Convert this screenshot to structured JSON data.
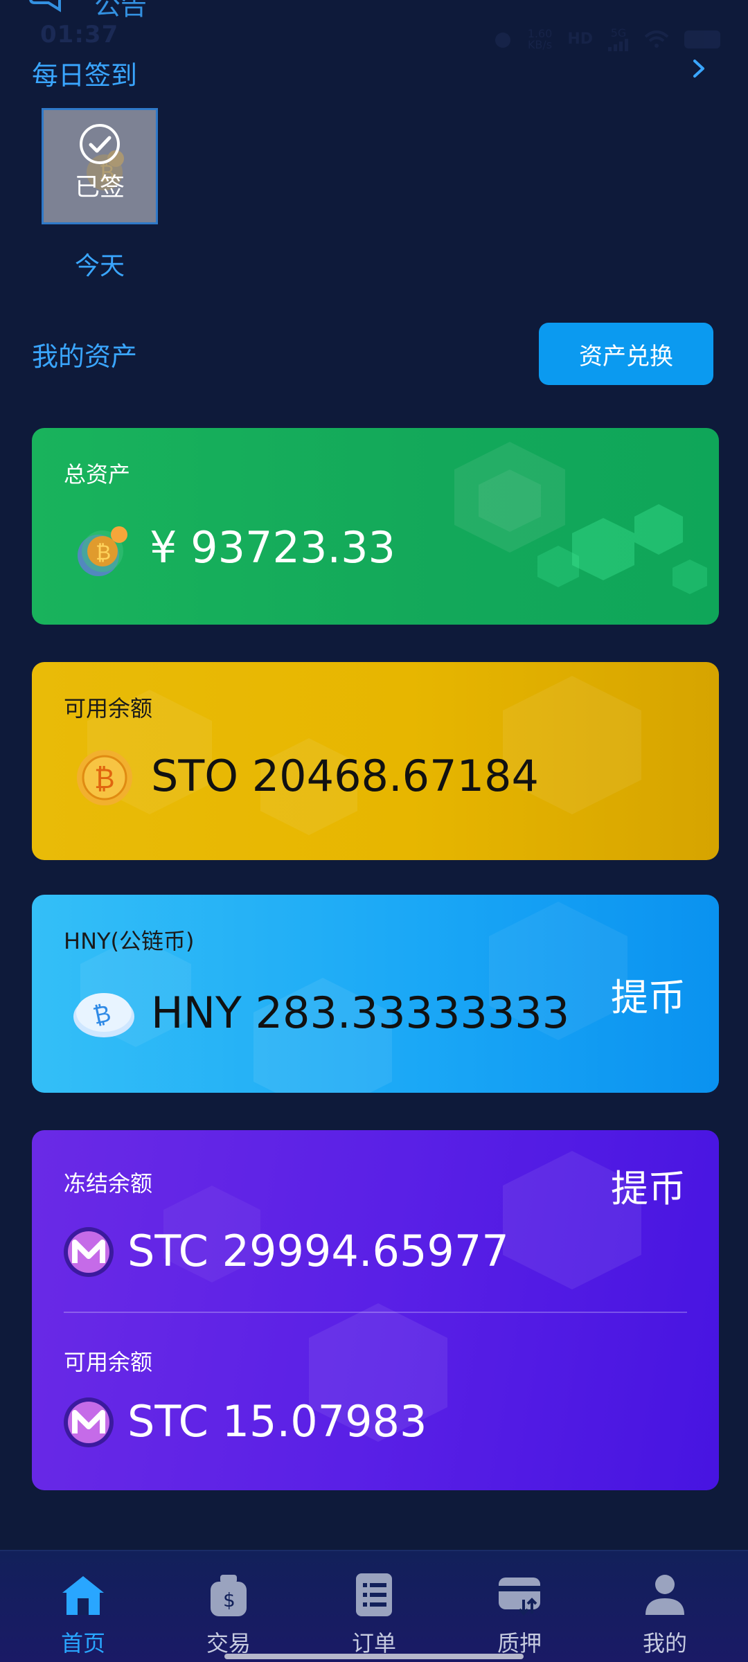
{
  "status_bar": {
    "time": "01:37",
    "net_speed_value": "1.60",
    "net_speed_unit": "KB/s",
    "hd_badge": "HD",
    "signal_gen": "5G",
    "notice_label": "公告"
  },
  "daily_checkin": {
    "title": "每日签到",
    "status": "已签",
    "day_label": "今天"
  },
  "assets": {
    "title": "我的资产",
    "exchange_button": "资产兑换",
    "cards": {
      "total": {
        "label": "总资产",
        "amount": "¥ 93723.33"
      },
      "sto": {
        "label": "可用余额",
        "amount": "STO 20468.67184"
      },
      "hny": {
        "label": "HNY(公链币)",
        "amount": "HNY 283.33333333",
        "action": "提币"
      },
      "stc": {
        "action": "提币",
        "frozen_label": "冻结余额",
        "frozen_amount": "STC 29994.65977",
        "available_label": "可用余额",
        "available_amount": "STC 15.07983"
      }
    },
    "colors": {
      "total": "#19b35c",
      "sto": "#e7b600",
      "hny": "#1ba8f6",
      "stc": "#5a20e6",
      "accent": "#3aa6ff"
    }
  },
  "bottom_nav": {
    "items": [
      {
        "label": "首页",
        "icon": "home-icon",
        "active": true
      },
      {
        "label": "交易",
        "icon": "money-bag-icon",
        "active": false
      },
      {
        "label": "订单",
        "icon": "order-list-icon",
        "active": false
      },
      {
        "label": "质押",
        "icon": "pledge-card-icon",
        "active": false
      },
      {
        "label": "我的",
        "icon": "profile-icon",
        "active": false
      }
    ]
  }
}
